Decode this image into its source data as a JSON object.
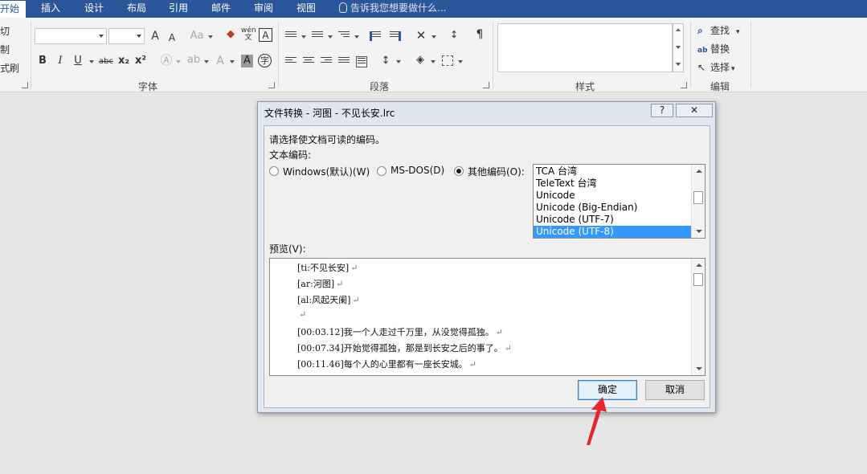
{
  "tabs": [
    "开始",
    "插入",
    "设计",
    "布局",
    "引用",
    "邮件",
    "审阅",
    "视图"
  ],
  "tell_me": "告诉我您想要做什么...",
  "clipboard": {
    "items": [
      "剪切",
      "复制",
      "格式刷"
    ]
  },
  "groups": {
    "font": "字体",
    "paragraph": "段落",
    "styles": "样式",
    "editing": "编辑"
  },
  "editing": {
    "find": "查找",
    "replace": "替换",
    "select": "选择"
  },
  "font_glyphs": {
    "grow": "A",
    "shrink": "A",
    "case": "Aa",
    "bold": "B",
    "italic": "I",
    "underline": "U",
    "strike": "abc",
    "sub": "x₂",
    "sup": "x²",
    "phonetic": "wén",
    "border_char": "A"
  },
  "dialog": {
    "title": "文件转换 - 河图 - 不见长安.lrc",
    "help_label": "?",
    "close_label": "✕",
    "instruction": "请选择使文档可读的编码。",
    "encoding_label": "文本编码:",
    "options": [
      {
        "label": "Windows(默认)(W)",
        "checked": false
      },
      {
        "label": "MS-DOS(D)",
        "checked": false
      },
      {
        "label": "其他编码(O):",
        "checked": true
      }
    ],
    "encodings": [
      "TCA 台湾",
      "TeleText 台湾",
      "Unicode",
      "Unicode (Big-Endian)",
      "Unicode (UTF-7)",
      "Unicode (UTF-8)"
    ],
    "selected_encoding": "Unicode (UTF-8)",
    "preview_label": "预览(V):",
    "preview_lines": [
      "[ti:不见长安]",
      "[ar:河图]",
      "[al:风起天阑]",
      "",
      "[00:03.12]我一个人走过千万里，从没觉得孤独。",
      "[00:07.34]开始觉得孤独，那是到长安之后的事了。",
      "[00:11.46]每个人的心里都有一座长安城。"
    ],
    "return_mark": "↵",
    "ok_label": "确定",
    "cancel_label": "取消"
  },
  "colors": {
    "ribbon_tab": "#2b579a",
    "selection": "#3399ff",
    "arrow": "#e8242c"
  }
}
